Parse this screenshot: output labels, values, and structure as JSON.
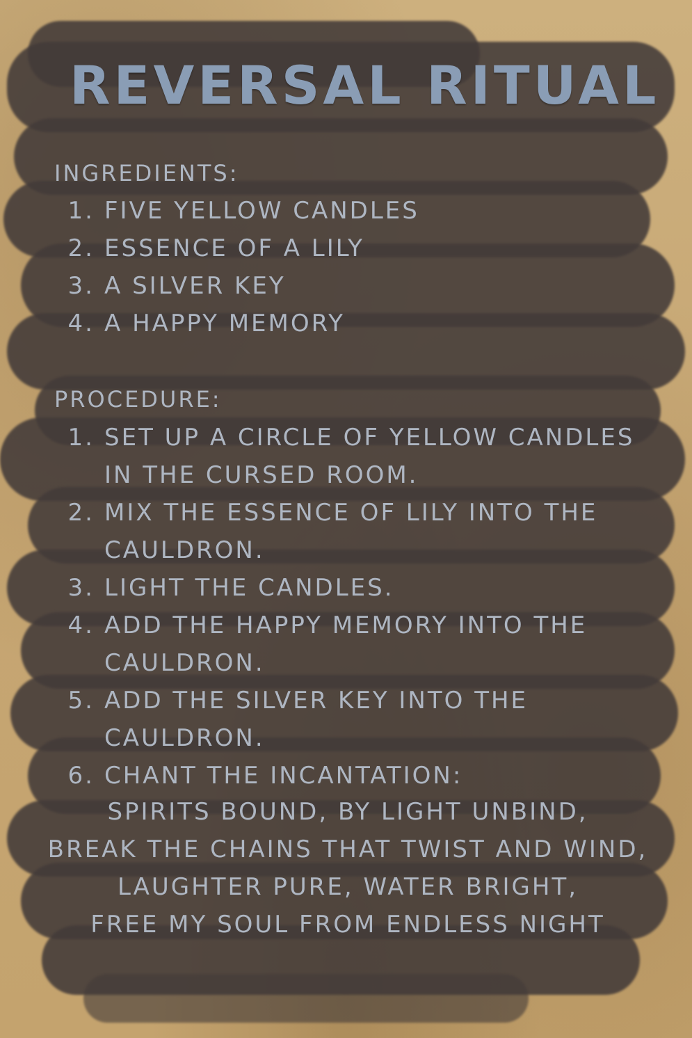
{
  "title": "Reversal Ritual",
  "ingredients": {
    "heading": "Ingredients:",
    "items": [
      {
        "num": "1.",
        "text": "Five Yellow Candles"
      },
      {
        "num": "2.",
        "text": "Essence of a Lily"
      },
      {
        "num": "3.",
        "text": "A Silver Key"
      },
      {
        "num": "4.",
        "text": "A happy memory"
      }
    ]
  },
  "procedure": {
    "heading": "Procedure:",
    "items": [
      {
        "num": "1.",
        "text": "Set up a circle of yellow candles in the cursed room."
      },
      {
        "num": "2.",
        "text": "Mix the Essence of Lily into the cauldron."
      },
      {
        "num": "3.",
        "text": "Light the candles."
      },
      {
        "num": "4.",
        "text": "Add the happy memory into the cauldron."
      },
      {
        "num": "5.",
        "text": "Add the Silver Key into the cauldron."
      },
      {
        "num": "6.",
        "text": "Chant the incantation:"
      }
    ]
  },
  "incantation": [
    "Spirits bound, by light unbind,",
    "Break the chains that twist and wind,",
    "Laughter pure, water bright,",
    "Free my soul from endless night"
  ]
}
